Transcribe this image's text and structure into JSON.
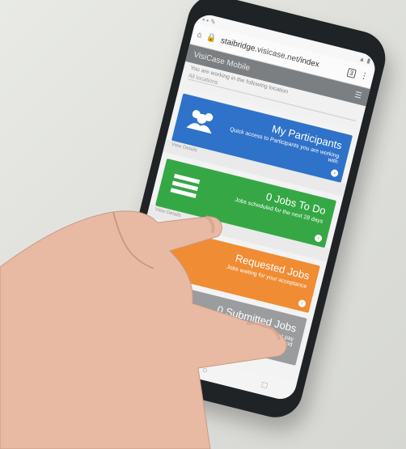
{
  "browser": {
    "url_prefix": "staibridge.",
    "url_domain": "visicase.net",
    "url_path": "/index",
    "tab_count": "3"
  },
  "app": {
    "title": "VisiCase Mobile",
    "location_label": "You are working in the following location",
    "location_select": "All locations"
  },
  "cards": [
    {
      "title": "My Participants",
      "subtitle": "Quick access to Participants you are working with",
      "footer": "View Details",
      "color": "#2f72c9",
      "icon": "people-icon"
    },
    {
      "title": "0 Jobs To Do",
      "subtitle": "Jobs scheduled for the next 28 days",
      "footer": "View Details",
      "color": "#35a845",
      "icon": "list-icon"
    },
    {
      "title": "Requested Jobs",
      "subtitle": "Jobs waiting for your acceptance",
      "footer": "",
      "color": "#f08c33",
      "icon": ""
    },
    {
      "title": "0 Submitted Jobs",
      "subtitle": "Job your submitted jobs here in current pay period",
      "footer": "",
      "color": "#9a9c9e",
      "icon": ""
    }
  ],
  "nav": {
    "back": "◁",
    "home": "○",
    "recent": "□"
  }
}
